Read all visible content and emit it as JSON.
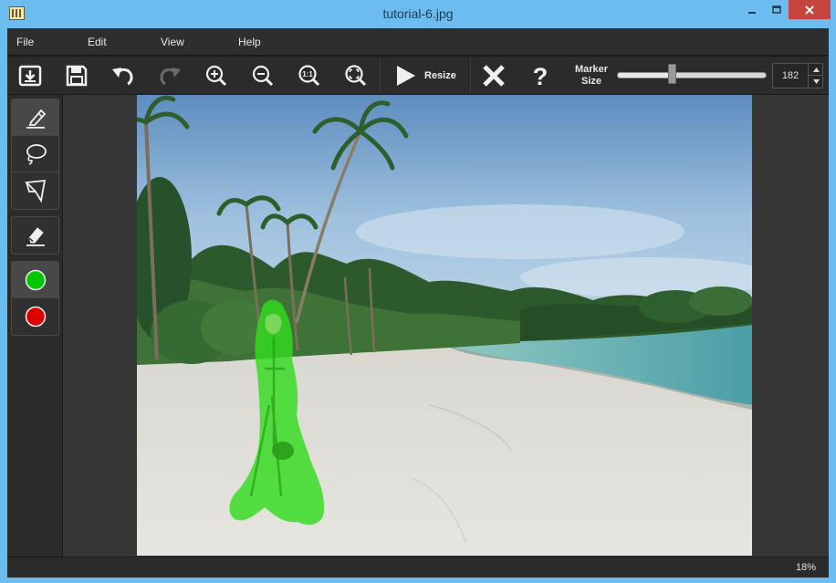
{
  "window": {
    "title": "tutorial-6.jpg"
  },
  "menu": {
    "items": [
      "File",
      "Edit",
      "View",
      "Help"
    ]
  },
  "toolbar": {
    "resize_label": "Resize",
    "marker_label_line1": "Marker",
    "marker_label_line2": "Size",
    "marker_size_value": "182",
    "marker_size_fraction": 0.37,
    "icons": [
      "open-icon",
      "save-icon",
      "undo-icon",
      "redo-icon",
      "zoom-in-icon",
      "zoom-out-icon",
      "zoom-actual-icon",
      "zoom-fit-icon",
      "play-icon",
      "clear-icon",
      "help-icon"
    ]
  },
  "tools": {
    "selection": [
      "marker-icon",
      "lasso-icon",
      "polygon-lasso-icon"
    ],
    "eraser": "eraser-icon",
    "colors": [
      {
        "name": "keep",
        "color": "#00c800"
      },
      {
        "name": "remove",
        "color": "#dc0000"
      }
    ]
  },
  "status": {
    "zoom": "18%"
  },
  "colors": {
    "accent": "#6cbcf0",
    "close": "#c7453f",
    "mask": "#32dc1e"
  }
}
